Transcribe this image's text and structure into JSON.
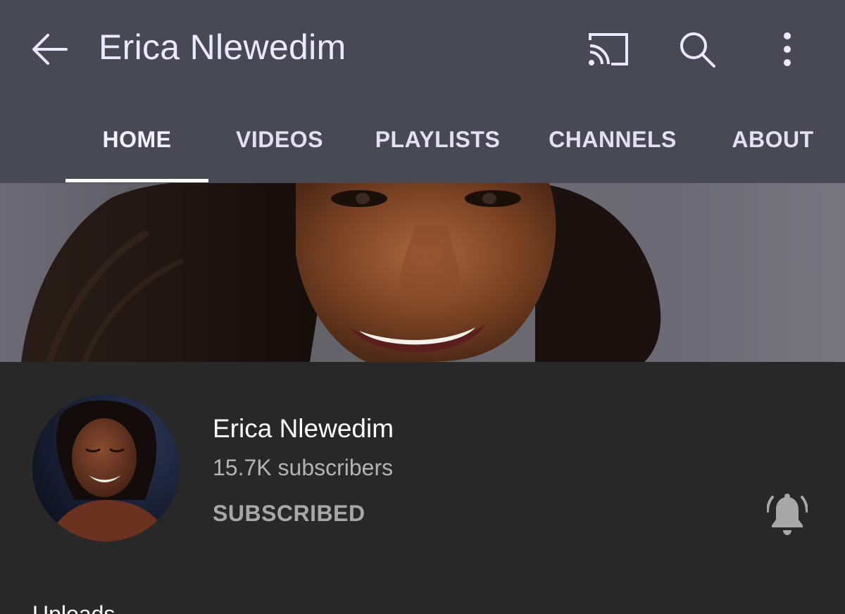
{
  "appbar": {
    "title": "Erica Nlewedim",
    "icons": [
      "back-arrow-icon",
      "cast-icon",
      "search-icon",
      "more-vert-icon"
    ]
  },
  "tabs": [
    {
      "label": "HOME",
      "active": true
    },
    {
      "label": "VIDEOS",
      "active": false
    },
    {
      "label": "PLAYLISTS",
      "active": false
    },
    {
      "label": "CHANNELS",
      "active": false
    },
    {
      "label": "ABOUT",
      "active": false
    }
  ],
  "channel": {
    "name": "Erica Nlewedim",
    "subscribers": "15.7K subscribers",
    "subscribe_state": "SUBSCRIBED",
    "bell_icon": "notification-bell-icon"
  },
  "section": {
    "partial_heading": "Uploads"
  },
  "colors": {
    "appbar": "#494855",
    "body": "#282828",
    "tab_text": "#e4e0f2",
    "secondary_text": "#b3b3b3"
  }
}
